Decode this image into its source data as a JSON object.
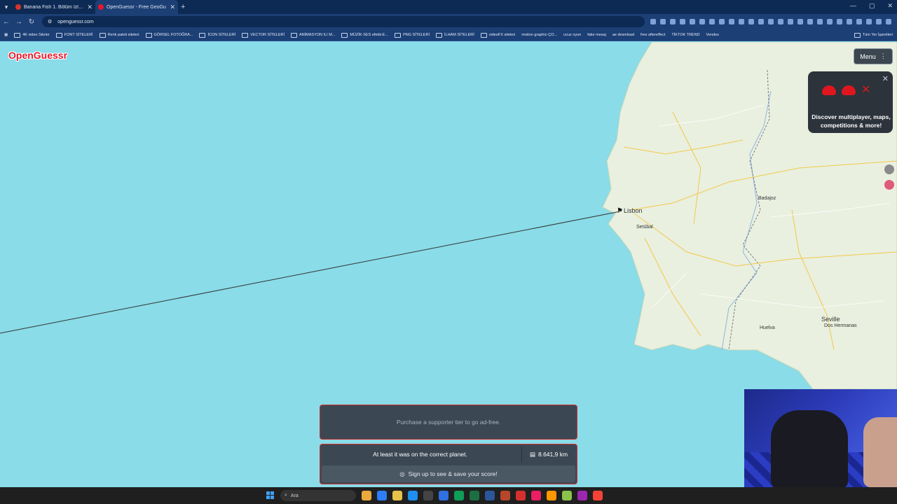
{
  "browser": {
    "tabs": [
      {
        "title": "Banana Fish 1. Bölüm İzle - Ani",
        "favicon_color": "#d9342b",
        "active": false
      },
      {
        "title": "OpenGuessr - Free GeoGu",
        "favicon_color": "#e8162a",
        "active": true
      }
    ],
    "url": "openguessr.com",
    "bookmarks": [
      "4K video Siteler",
      "FONT SİTELERİ",
      "Renk paleti siteleri",
      "GÖRSEL FOTOĞRA...",
      "İCON SİTELERİ",
      "VECTOR SİTELERİ",
      "ANİMASYON ILI M...",
      "MÜZİK-SES efekti-E...",
      "PNG SİTELERİ",
      "İLHAM SİTELERİ",
      "videoFX siteleri",
      "motion graphic-ÇO...",
      "ucuz oyun",
      "fake mesaj",
      "ae download",
      "free aftereffect",
      "TİKTOK TREND",
      "Vendes"
    ],
    "bookmarks_end": "Tüm Yer İşaretleri"
  },
  "game": {
    "logo": "OpenGuessr",
    "menu_label": "Menu",
    "promo_text": "Discover multiplayer, maps, competitions & more!",
    "ad_text": "Purchase a supporter tier to go ad-free.",
    "result_message": "At least it was on the correct planet.",
    "distance": "8.641,9 km",
    "signup_text": "Sign up to see & save your score!"
  },
  "map": {
    "cities": [
      "Lisbon",
      "Seville",
      "Dos Hermanas",
      "Huelva",
      "Badajoz",
      "Setúbal"
    ],
    "line_color": "#333333",
    "water_color": "#89dce8",
    "land_color": "#e9f0df"
  },
  "taskbar": {
    "search_text": "Ara",
    "apps": [
      "#e9a93b",
      "#2d7df6",
      "#e6c24a",
      "#1f8ef1",
      "#444",
      "#2f6fe0",
      "#0f9d58",
      "#1d6f42",
      "#2b579a",
      "#b7472a",
      "#d4312e",
      "#e91e63",
      "#ff9800",
      "#8bc34a",
      "#9c27b0",
      "#f44336"
    ]
  }
}
